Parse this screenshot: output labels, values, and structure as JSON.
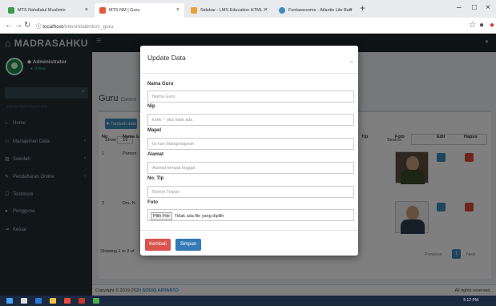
{
  "browser": {
    "tabs": [
      {
        "label": "MTS Nahdlatul Muslimin",
        "active": false
      },
      {
        "label": "MTS NM | Guru",
        "active": true
      },
      {
        "label": "Sidebar - LMS Education HTML \\",
        "active": false
      },
      {
        "label": "Fontawesome - Atlantis Lite Boo",
        "active": false
      }
    ],
    "url_host": "localhost",
    "url_path": "/mtsnm/admin/c_guru"
  },
  "app": {
    "brand": "MADRASAHKU",
    "user_name": "Administrator",
    "user_status": "Online",
    "sidebar_header": "MAIN NAVIGATION",
    "sidebar_items": [
      {
        "label": "Home",
        "icon": "home-icon",
        "has_children": false
      },
      {
        "label": "Manajemen Data",
        "icon": "database-icon",
        "has_children": true
      },
      {
        "label": "Sekolah",
        "icon": "building-icon",
        "has_children": true
      },
      {
        "label": "Pendaftaran Online",
        "icon": "edit-icon",
        "has_children": true
      },
      {
        "label": "Testimoni",
        "icon": "comment-icon",
        "has_children": false
      },
      {
        "label": "Pengguna",
        "icon": "users-icon",
        "has_children": false
      },
      {
        "label": "Keluar",
        "icon": "sign-out-icon",
        "has_children": false
      }
    ],
    "page_title": "Guru",
    "page_subtitle": "Control"
  },
  "table": {
    "add_button": "Tambah data",
    "show_label": "Show",
    "show_value": "10",
    "search_label": "Search:",
    "columns": [
      "No",
      "Nama G",
      "Tlp",
      "Foto",
      "Edit",
      "Hapus"
    ],
    "rows": [
      {
        "no": "1",
        "nama": "Pamon"
      },
      {
        "no": "2",
        "nama": "Drs. N"
      }
    ],
    "info": "Showing 1 to 2 of",
    "prev_label": "Previous",
    "page": "1",
    "next_label": "Next"
  },
  "footer": {
    "copyright": "Copyright © 2019-2020",
    "owner": "SODIQ ARYANTO",
    "rights": "All rights reserved."
  },
  "taskbar": {
    "time": "5:12 PM"
  },
  "modal": {
    "title": "Update Data",
    "fields": [
      {
        "label": "Nama Guru",
        "placeholder": "Nama Guru"
      },
      {
        "label": "Nip",
        "placeholder": "ketik '-' jika tidak ada"
      },
      {
        "label": "Mapel",
        "placeholder": "Isi kan Matapelajaran"
      },
      {
        "label": "Alamat",
        "placeholder": "Alamat tempat tinggal"
      },
      {
        "label": "No. Tlp",
        "placeholder": "Nomor Telpon"
      }
    ],
    "photo_label": "Foto",
    "file_button": "Pilih File",
    "file_status": "Tidak ada file yang dipilih",
    "back_button": "Kembali",
    "save_button": "Simpan"
  },
  "colors": {
    "sidebar": "#222d32",
    "primary": "#3c8dbc",
    "danger": "#dd4b39",
    "modal_back": "#d9534f",
    "modal_save": "#337ab7"
  }
}
